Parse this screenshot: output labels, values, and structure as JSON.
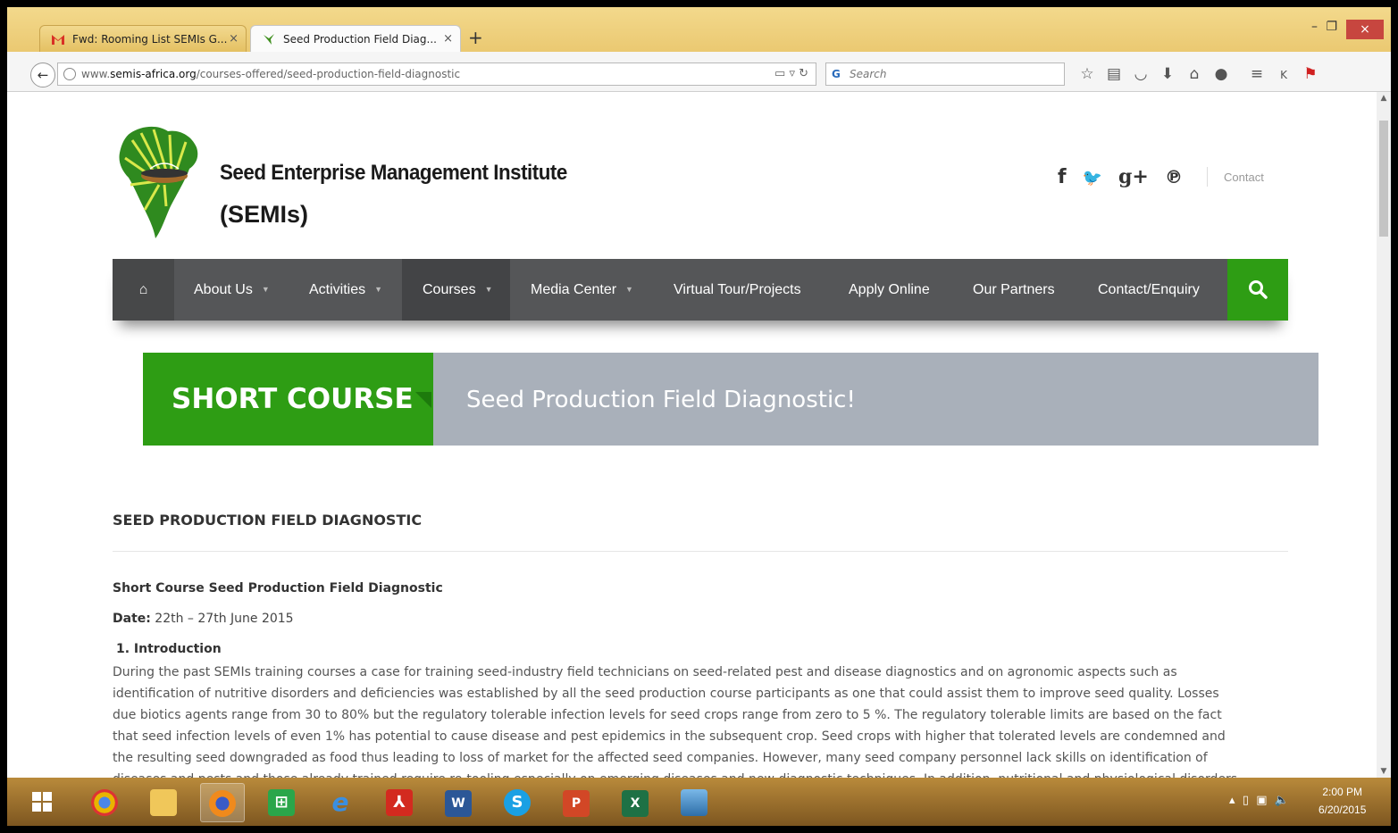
{
  "browser": {
    "tabs": [
      {
        "label": "Fwd: Rooming List SEMIs G...",
        "close": "×"
      },
      {
        "label": "Seed Production Field Diag...",
        "close": "×"
      }
    ],
    "new_tab": "+",
    "window_controls": {
      "minimize": "–",
      "restore": "❐",
      "close": "×"
    },
    "url_prefix": "www.",
    "url_domain": "semis-africa.org",
    "url_path": "/courses-offered/seed-production-field-diagnostic",
    "search_placeholder": "Search",
    "toolbar_icons": [
      "star-icon",
      "reading-list-icon",
      "pocket-icon",
      "download-icon",
      "home-icon",
      "chat-icon",
      "menu-icon",
      "k-icon",
      "flag-icon"
    ]
  },
  "site": {
    "title_line1": "Seed Enterprise Management Institute",
    "title_line2": "(SEMIs)",
    "social": {
      "facebook": "f",
      "twitter": "🐦",
      "gplus": "g+",
      "pinterest": "℗"
    },
    "contact_link": "Contact"
  },
  "nav": {
    "home": "⌂",
    "items": [
      {
        "label": "About Us",
        "dropdown": true
      },
      {
        "label": "Activities",
        "dropdown": true
      },
      {
        "label": "Courses",
        "dropdown": true,
        "active": true
      },
      {
        "label": "Media Center",
        "dropdown": true
      },
      {
        "label": "Virtual Tour/Projects"
      },
      {
        "label": "Apply Online"
      },
      {
        "label": "Our Partners"
      },
      {
        "label": "Contact/Enquiry"
      }
    ],
    "search": "Q"
  },
  "banner": {
    "label": "SHORT COURSE",
    "title": "Seed Production Field Diagnostic!"
  },
  "article": {
    "heading": "SEED PRODUCTION FIELD DIAGNOSTIC",
    "subheading": "Short Course Seed Production Field Diagnostic",
    "date_label": "Date:",
    "date_value": " 22th  – 27th June 2015",
    "intro_heading": "1.   Introduction",
    "lines": [
      "During the past SEMIs training courses a case for training seed-industry field technicians on seed-related pest and disease diagnostics and on agronomic aspects such as",
      "identification of nutritive disorders and deficiencies was established by all the seed production course participants as one that could assist them to improve seed quality. Losses",
      "due biotics agents range from 30 to 80% but the regulatory tolerable infection levels for seed crops range from zero to 5 %. The regulatory tolerable limits are based on the fact",
      "that seed infection levels of even 1% has potential to cause disease and pest epidemics in the subsequent crop.  Seed crops with higher that tolerated levels are condemned and",
      "the resulting seed downgraded as food thus leading to loss of market for the affected seed companies. However, many seed company personnel lack skills on identification of",
      "diseases and pests and those already trained require re-tooling especially on emerging diseases and new diagnostic techniques. In addition, nutritional and physiological disorders"
    ]
  },
  "taskbar": {
    "apps": [
      "windows-start-icon",
      "chrome-icon",
      "file-explorer-icon",
      "firefox-icon",
      "store-icon",
      "internet-explorer-icon",
      "acrobat-icon",
      "word-icon",
      "skype-icon",
      "powerpoint-icon",
      "excel-icon",
      "photos-icon"
    ],
    "time": "2:00 PM",
    "date": "6/20/2015"
  },
  "colors": {
    "green": "#2e9d14",
    "nav_bg": "#555658",
    "banner_grey": "#a9b0ba",
    "taskbar": "#a57530"
  }
}
